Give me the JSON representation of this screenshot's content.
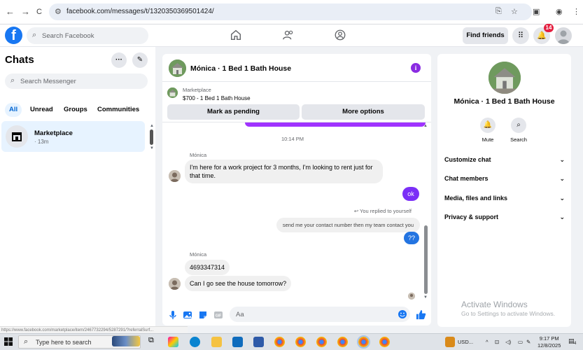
{
  "browser": {
    "url": "facebook.com/messages/t/1320350369501424/",
    "back": "←",
    "forward": "→",
    "reload": "C"
  },
  "header": {
    "search_placeholder": "Search Facebook",
    "find_friends": "Find friends",
    "notification_count": "14"
  },
  "sidebar": {
    "title": "Chats",
    "search_placeholder": "Search Messenger",
    "filters": [
      "All",
      "Unread",
      "Groups",
      "Communities"
    ],
    "chat": {
      "name": "Marketplace",
      "time": "· 13m"
    }
  },
  "conversation": {
    "title": "Mónica · 1 Bed 1 Bath House",
    "marketplace_label": "Marketplace",
    "listing": "$700 - 1 Bed 1 Bath House",
    "mark_pending": "Mark as pending",
    "more_options": "More options",
    "timestamp": "10:14 PM",
    "sender_1": "Mónica",
    "message_1": "I'm here for a work project for 3 months, I'm looking to rent just for that time.",
    "reply_ok": "ok",
    "reply_note": "You replied to yourself",
    "quoted": "send me your contact number then my team contact you",
    "reply_qq": "??",
    "sender_2": "Mónica",
    "message_2": "4693347314",
    "message_3": "Can I go see the house tomorrow?",
    "composer_placeholder": "Aa"
  },
  "details": {
    "name": "Mónica · 1 Bed 1 Bath House",
    "mute": "Mute",
    "search": "Search",
    "sections": [
      "Customize chat",
      "Chat members",
      "Media, files and links",
      "Privacy & support"
    ],
    "watermark_title": "Activate Windows",
    "watermark_sub": "Go to Settings to activate Windows."
  },
  "status_url": "https://www.facebook.com/marketplace/item/2467732294/5287291/?referralSurf...",
  "taskbar": {
    "search_placeholder": "Type here to search",
    "tray_text": "USD...",
    "time": "9:17 PM",
    "date": "12/8/2025",
    "notif": "4"
  },
  "colors": {
    "fb_blue": "#1877f2",
    "bubble_purple": "#7b2ff7",
    "bubble_blue": "#2374e1"
  }
}
